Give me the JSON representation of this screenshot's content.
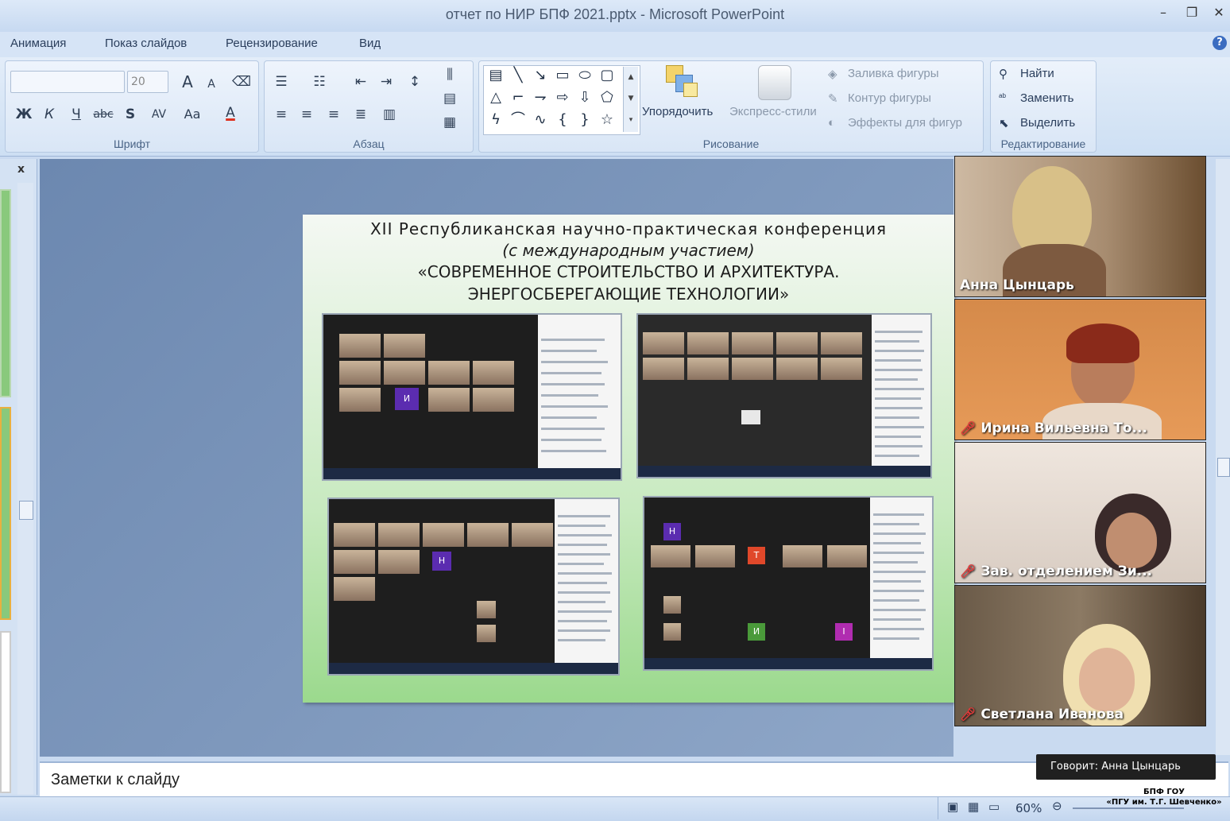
{
  "window": {
    "title": "отчет по НИР БПФ 2021.pptx - Microsoft PowerPoint",
    "minimize": "–",
    "restore": "❐",
    "close": "✕"
  },
  "menu_tabs": [
    "Анимация",
    "Показ слайдов",
    "Рецензирование",
    "Вид"
  ],
  "help_icon": "?",
  "ribbon": {
    "font_group": {
      "label": "Шрифт",
      "font_name_value": "",
      "font_size_value": "20",
      "grow": "A",
      "shrink": "A",
      "bold": "Ж",
      "italic": "К",
      "underline": "Ч",
      "strike": "abc",
      "shadow": "S",
      "spacing": "AV",
      "case": "Aa",
      "color": "A"
    },
    "paragraph_group": {
      "label": "Абзац"
    },
    "drawing_group": {
      "label": "Рисование",
      "arrange": "Упорядочить",
      "quick_styles": "Экспресс-стили",
      "shape_fill": "Заливка фигуры",
      "shape_outline": "Контур фигуры",
      "shape_effects": "Эффекты для фигур"
    },
    "editing_group": {
      "label": "Редактирование",
      "find": "Найти",
      "replace": "Заменить",
      "select": "Выделить"
    }
  },
  "left_pane_close": "x",
  "slide": {
    "line1": "XII Республиканская научно-практическая конференция",
    "line2": "(с международным участием)",
    "line3": "«СОВРЕМЕННОЕ СТРОИТЕЛЬСТВО И АРХИТЕКТУРА.",
    "line4": "ЭНЕРГОСБЕРЕГАЮЩИЕ ТЕХНОЛОГИИ»",
    "avatar_letters": [
      "И",
      "Н",
      "Н",
      "Т",
      "И",
      "I"
    ]
  },
  "notes_placeholder": "Заметки к слайду",
  "status": {
    "zoom": "60%"
  },
  "participants": [
    {
      "name": "Анна Цынцарь",
      "muted": false
    },
    {
      "name": "Ирина Вильевна То...",
      "muted": true
    },
    {
      "name": "Зав. отделением Зи...",
      "muted": true
    },
    {
      "name": "Светлана Иванова",
      "muted": true
    }
  ],
  "speaking_banner": "Говорит: Анна Цынцарь",
  "watermark": {
    "line1": "БПФ ГОУ",
    "line2": "«ПГУ им. Т.Г. Шевченко»"
  },
  "colors": {
    "accent": "#c9daf0",
    "muted_mic": "#e23b3b",
    "avatar_purple": "#5b2cb0"
  }
}
